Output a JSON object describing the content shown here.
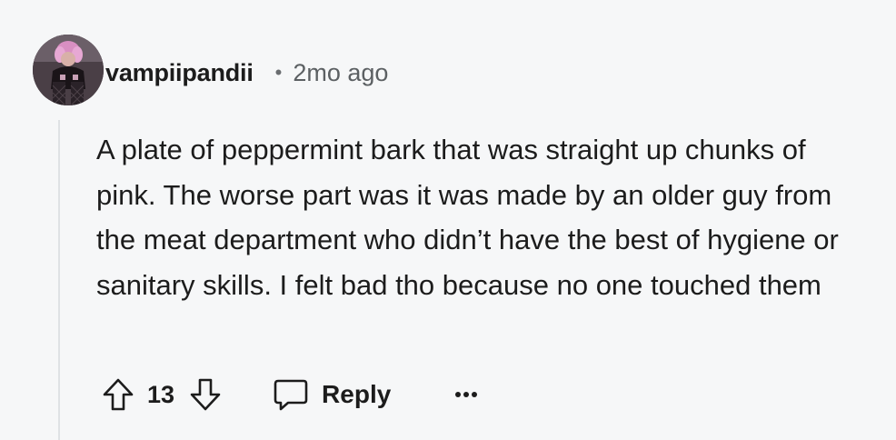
{
  "comment": {
    "username": "vampiipandii",
    "separator": "•",
    "timestamp": "2mo ago",
    "body": "A plate of peppermint bark that was straight up chunks of pink. The worse part was it was made by an older guy from the meat department who didn’t have the best of hygiene or sanitary skills. I felt bad tho because no one touched them",
    "score": "13",
    "reply_label": "Reply",
    "icons": {
      "upvote": "arrow-up-outline-icon",
      "downvote": "arrow-down-outline-icon",
      "reply": "speech-bubble-icon",
      "more": "ellipsis-icon"
    }
  },
  "colors": {
    "background": "#f6f7f8",
    "text": "#1c1c1c",
    "muted": "#5c6063",
    "thread_line": "#dfe2e5"
  }
}
